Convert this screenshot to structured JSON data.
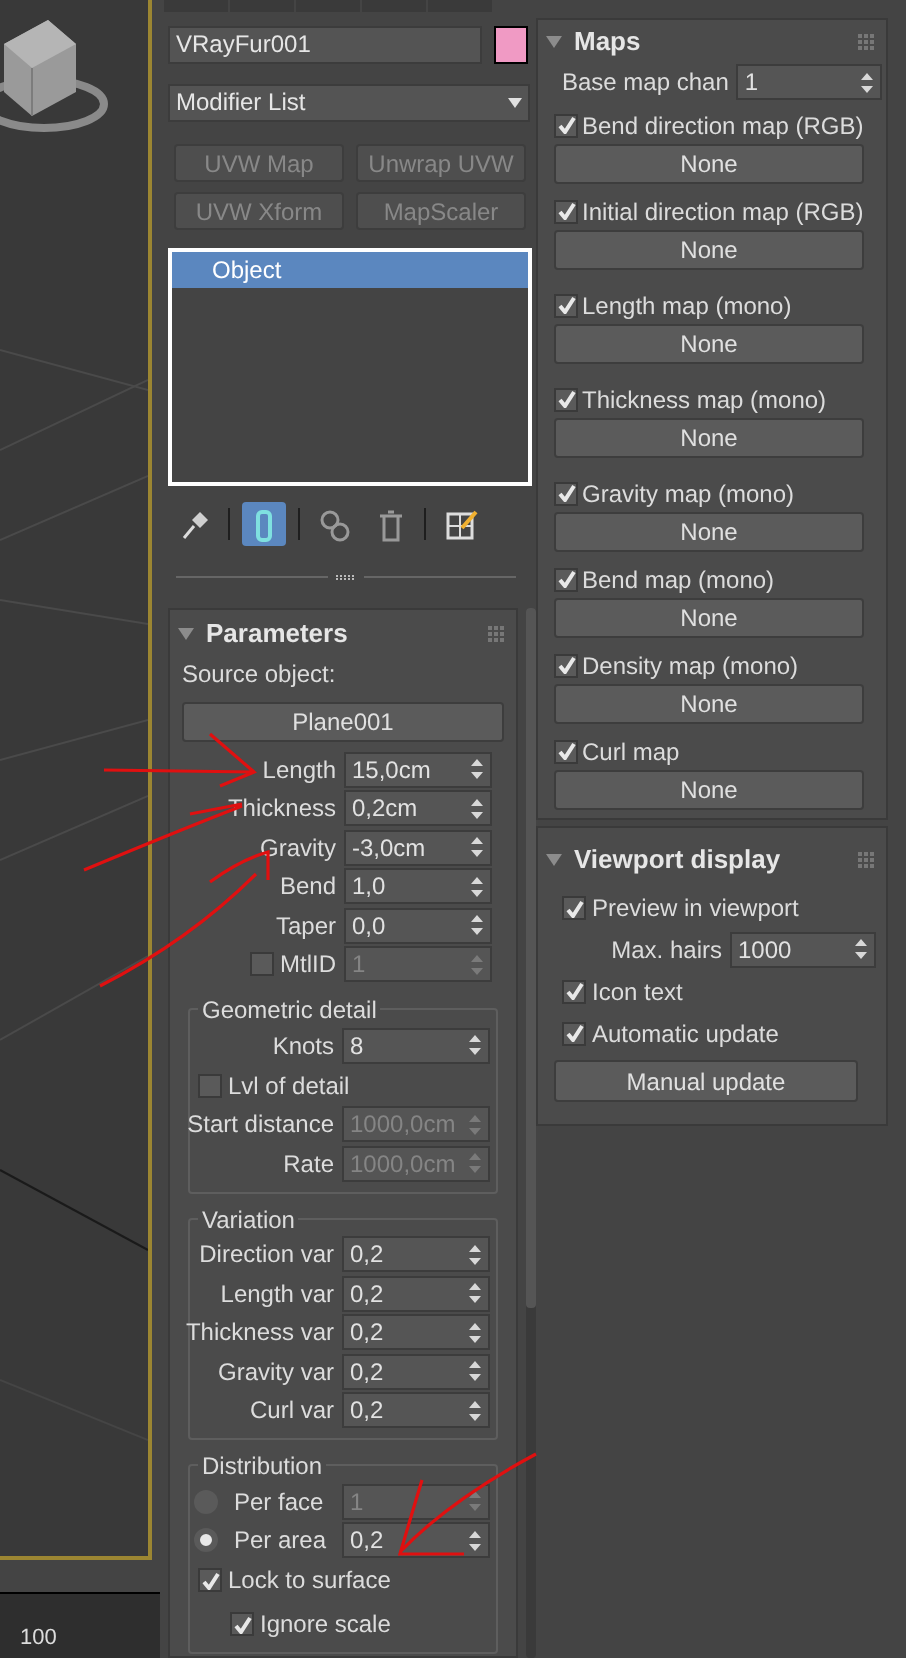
{
  "viewport": {
    "timeline_label": "100"
  },
  "object": {
    "name": "VRayFur001",
    "color": "#f09ac4"
  },
  "modifier_list": {
    "label": "Modifier List"
  },
  "modifier_buttons": [
    "UVW Map",
    "Unwrap UVW",
    "UVW Xform",
    "MapScaler"
  ],
  "stack": [
    {
      "label": "Object",
      "selected": true
    }
  ],
  "stack_tools": [
    {
      "kind": "pin",
      "on": false
    },
    {
      "kind": "show-result",
      "on": true
    },
    {
      "kind": "make-unique",
      "on": false
    },
    {
      "kind": "remove",
      "on": false
    },
    {
      "kind": "configure",
      "on": false
    }
  ],
  "parameters": {
    "title": "Parameters",
    "expanded": true,
    "rows": [
      {
        "kind": "text",
        "label": "Source object:"
      },
      {
        "kind": "button",
        "label": "Plane001"
      },
      {
        "kind": "spinner",
        "label": "Length",
        "value": "15,0cm",
        "disabled": false
      },
      {
        "kind": "spinner",
        "label": "Thickness",
        "value": "0,2cm",
        "disabled": false
      },
      {
        "kind": "spinner",
        "label": "Gravity",
        "value": "-3,0cm",
        "disabled": false
      },
      {
        "kind": "spinner",
        "label": "Bend",
        "value": "1,0",
        "disabled": false
      },
      {
        "kind": "spinner",
        "label": "Taper",
        "value": "0,0",
        "disabled": false
      },
      {
        "kind": "check-spinner",
        "label": "MtlID",
        "value": "1",
        "checked": false,
        "disabled": true
      }
    ],
    "groups": [
      {
        "title": "Geometric detail",
        "rows": [
          {
            "kind": "spinner",
            "label": "Knots",
            "value": "8",
            "disabled": false
          },
          {
            "kind": "checkbox",
            "label": "Lvl of detail",
            "checked": false
          },
          {
            "kind": "spinner",
            "label": "Start distance",
            "value": "1000,0cm",
            "disabled": true
          },
          {
            "kind": "spinner",
            "label": "Rate",
            "value": "1000,0cm",
            "disabled": true
          }
        ]
      },
      {
        "title": "Variation",
        "rows": [
          {
            "kind": "spinner",
            "label": "Direction var",
            "value": "0,2",
            "disabled": false
          },
          {
            "kind": "spinner",
            "label": "Length var",
            "value": "0,2",
            "disabled": false
          },
          {
            "kind": "spinner",
            "label": "Thickness var",
            "value": "0,2",
            "disabled": false
          },
          {
            "kind": "spinner",
            "label": "Gravity var",
            "value": "0,2",
            "disabled": false
          },
          {
            "kind": "spinner",
            "label": "Curl var",
            "value": "0,2",
            "disabled": false
          }
        ]
      },
      {
        "title": "Distribution",
        "rows": [
          {
            "kind": "radio-spinner",
            "label": "Per face",
            "value": "1",
            "selected": false,
            "disabled": true
          },
          {
            "kind": "radio-spinner",
            "label": "Per area",
            "value": "0,2",
            "selected": true,
            "disabled": false
          },
          {
            "kind": "checkbox",
            "label": "Lock to surface",
            "checked": true,
            "children": [
              {
                "kind": "checkbox",
                "label": "Ignore scale",
                "checked": true
              }
            ]
          }
        ]
      }
    ]
  },
  "maps": {
    "title": "Maps",
    "expanded": true,
    "base_map_channel": {
      "label": "Base map chan",
      "value": "1"
    },
    "items": [
      {
        "label": "Bend direction map (RGB)",
        "checked": true,
        "button": "None"
      },
      {
        "label": "Initial direction map (RGB)",
        "checked": true,
        "button": "None"
      },
      {
        "label": "Length map (mono)",
        "checked": true,
        "button": "None"
      },
      {
        "label": "Thickness map (mono)",
        "checked": true,
        "button": "None"
      },
      {
        "label": "Gravity map (mono)",
        "checked": true,
        "button": "None"
      },
      {
        "label": "Bend map (mono)",
        "checked": true,
        "button": "None"
      },
      {
        "label": "Density map (mono)",
        "checked": true,
        "button": "None"
      },
      {
        "label": "Curl map",
        "checked": true,
        "button": "None"
      }
    ]
  },
  "viewport_display": {
    "title": "Viewport display",
    "expanded": true,
    "rows": [
      {
        "kind": "checkbox",
        "label": "Preview in viewport",
        "checked": true
      },
      {
        "kind": "spinner",
        "label": "Max. hairs",
        "value": "1000",
        "disabled": false
      },
      {
        "kind": "checkbox",
        "label": "Icon text",
        "checked": true
      },
      {
        "kind": "checkbox",
        "label": "Automatic update",
        "checked": true
      },
      {
        "kind": "button",
        "label": "Manual update"
      }
    ]
  }
}
